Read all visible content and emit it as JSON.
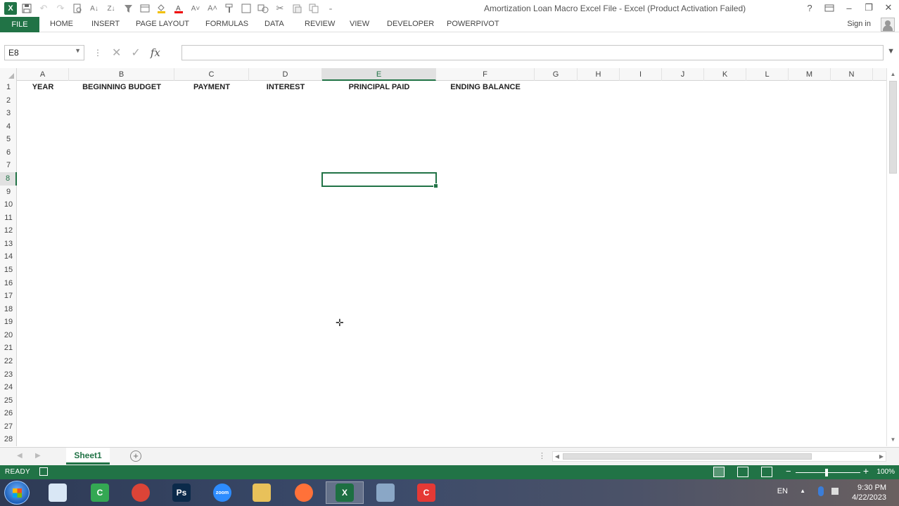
{
  "window": {
    "title": "Amortization Loan Macro Excel File - Excel (Product Activation Failed)",
    "help": "?",
    "minimize": "–",
    "restore": "❐",
    "close": "✕"
  },
  "ribbon": {
    "tabs": [
      "FILE",
      "HOME",
      "INSERT",
      "PAGE LAYOUT",
      "FORMULAS",
      "DATA",
      "REVIEW",
      "VIEW",
      "DEVELOPER",
      "POWERPIVOT"
    ],
    "sign_in": "Sign in"
  },
  "formula_bar": {
    "name_box": "E8",
    "cancel": "✕",
    "enter": "✓",
    "fx": "fx",
    "value": ""
  },
  "sheet": {
    "columns": [
      "A",
      "B",
      "C",
      "D",
      "E",
      "F",
      "G",
      "H",
      "I",
      "J",
      "K",
      "L",
      "M",
      "N"
    ],
    "active_column": "E",
    "active_row": 8,
    "row_count": 28,
    "header_row": [
      "YEAR",
      "BEGINNING BUDGET",
      "PAYMENT",
      "INTEREST",
      "PRINCIPAL PAID",
      "ENDING BALANCE"
    ]
  },
  "sheet_tabs": {
    "tabs": [
      "Sheet1"
    ],
    "add": "+"
  },
  "status_bar": {
    "ready": "READY",
    "zoom": "100%"
  },
  "taskbar": {
    "apps": [
      {
        "name": "notes",
        "label": "",
        "color": "#d9e7f5"
      },
      {
        "name": "camtasia",
        "label": "C",
        "color": "#34a853"
      },
      {
        "name": "chrome",
        "label": "",
        "color": "#db4437"
      },
      {
        "name": "photoshop",
        "label": "Ps",
        "color": "#0b2a4a"
      },
      {
        "name": "zoom",
        "label": "zoom",
        "color": "#2d8cff"
      },
      {
        "name": "explorer",
        "label": "",
        "color": "#e8c15a"
      },
      {
        "name": "firefox",
        "label": "",
        "color": "#ff7139"
      },
      {
        "name": "excel",
        "label": "X",
        "color": "#1d6f42"
      },
      {
        "name": "calculator",
        "label": "",
        "color": "#8aa7c6"
      },
      {
        "name": "recorder",
        "label": "C",
        "color": "#e53935"
      }
    ],
    "lang": "EN",
    "time": "9:30 PM",
    "date": "4/22/2023"
  }
}
